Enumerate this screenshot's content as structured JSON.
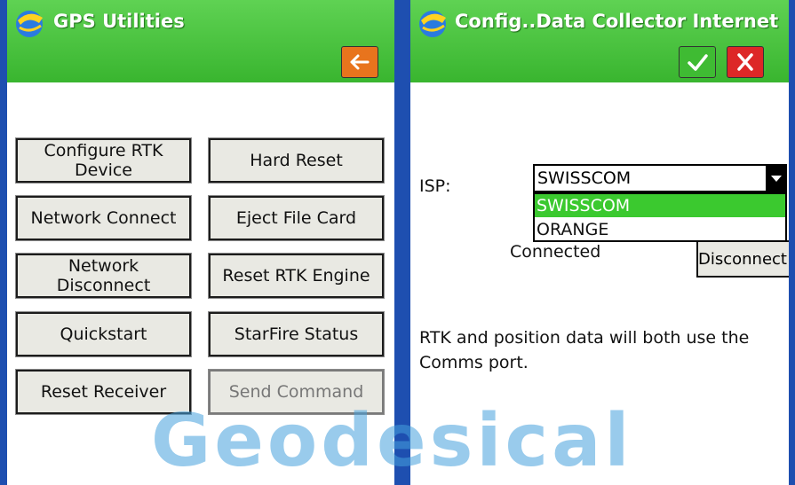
{
  "left_panel": {
    "title": "GPS Utilities",
    "back_button_icon": "arrow-left-icon",
    "buttons": [
      {
        "label": "Configure RTK Device"
      },
      {
        "label": "Hard Reset"
      },
      {
        "label": "Network Connect"
      },
      {
        "label": "Eject File Card"
      },
      {
        "label": "Network Disconnect"
      },
      {
        "label": "Reset RTK Engine"
      },
      {
        "label": "Quickstart"
      },
      {
        "label": "StarFire Status"
      },
      {
        "label": "Reset Receiver"
      },
      {
        "label": "Send Command",
        "disabled": true
      }
    ]
  },
  "right_panel": {
    "title": "Config..Data Collector Internet",
    "ok_icon": "checkmark-icon",
    "cancel_icon": "close-icon",
    "isp_label": "ISP:",
    "isp_selected": "SWISSCOM",
    "isp_options": [
      "SWISSCOM",
      "ORANGE"
    ],
    "status_text": "Connected",
    "disconnect_label": "Disconnect",
    "info_text": "RTK and position data will both use the Comms port."
  },
  "watermark": "Geodesical",
  "colors": {
    "header_green": "#3fbb33",
    "back_orange": "#e8741d",
    "cancel_red": "#dd2727",
    "frame_blue": "#1e4fb0",
    "selection_green": "#3bc92f"
  }
}
